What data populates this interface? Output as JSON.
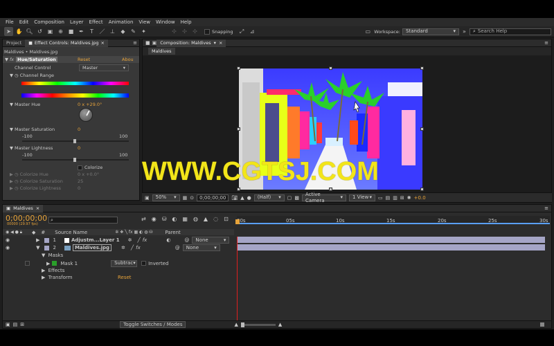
{
  "menu": [
    "File",
    "Edit",
    "Composition",
    "Layer",
    "Effect",
    "Animation",
    "View",
    "Window",
    "Help"
  ],
  "toolbar": {
    "snapping_label": "Snapping",
    "workspace_label": "Workspace:",
    "workspace_value": "Standard",
    "search_placeholder": "Search Help"
  },
  "left_panel": {
    "tab_project": "Project",
    "tab_effect_controls": "Effect Controls: Maldives.jpg",
    "breadcrumb": "Maldives • Maldives.jpg",
    "effect_name": "Hue/Saturation",
    "reset": "Reset",
    "about": "Abou",
    "channel_control_label": "Channel Control",
    "channel_control_value": "Master",
    "channel_range_label": "Channel Range",
    "master_hue_label": "Master Hue",
    "master_hue_value": "0 x +29.0°",
    "master_saturation_label": "Master Saturation",
    "master_saturation_value": "0",
    "sat_min": "-100",
    "sat_max": "100",
    "master_lightness_label": "Master Lightness",
    "master_lightness_value": "0",
    "light_min": "-100",
    "light_max": "100",
    "colorize_label": "Colorize",
    "colorize_hue_label": "Colorize Hue",
    "colorize_hue_value": "0 x +0.0°",
    "colorize_saturation_label": "Colorize Saturation",
    "colorize_saturation_value": "25",
    "colorize_lightness_label": "Colorize Lightness",
    "colorize_lightness_value": "0"
  },
  "comp": {
    "tab": "Composition: Maldives",
    "subtab": "Maldives",
    "zoom": "50%",
    "timecode": "0;00;00;00",
    "resolution": "(Half)",
    "camera": "Active Camera",
    "view": "1 View",
    "exposure": "+0.0",
    "watermark": "WWW.CGTSJ.COM"
  },
  "timeline": {
    "tab": "Maldives",
    "timecode": "0;00;00;00",
    "fps": "00000 (29.97 fps)",
    "col_num": "#",
    "col_source": "Source Name",
    "col_parent": "Parent",
    "layers": [
      {
        "num": "1",
        "name": "Adjustm...Layer 1",
        "parent": "None"
      },
      {
        "num": "2",
        "name": "Maldives.jpg",
        "parent": "None"
      }
    ],
    "masks_label": "Masks",
    "mask1_label": "Mask 1",
    "mask_mode": "Subtrac",
    "inverted_label": "Inverted",
    "effects_label": "Effects",
    "transform_label": "Transform",
    "transform_reset": "Reset",
    "ruler": [
      "00s",
      "05s",
      "10s",
      "15s",
      "20s",
      "25s",
      "30s"
    ],
    "toggle_label": "Toggle Switches / Modes"
  }
}
